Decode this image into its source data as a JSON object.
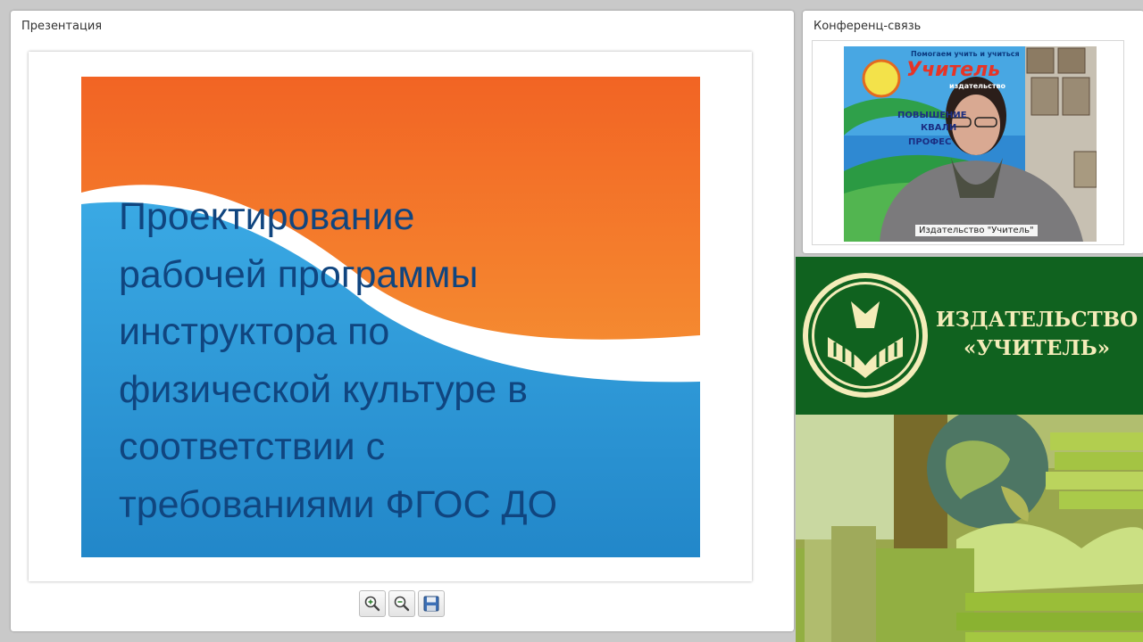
{
  "presentation": {
    "title": "Презентация",
    "slide": {
      "title": "Проектирование\nрабочей программы\nинструктора по\nфизической культуре в\nсоответствии с\nтребованиями ФГОС ДО"
    },
    "toolbar": {
      "zoom_in_icon": "zoom-in-icon",
      "zoom_out_icon": "zoom-out-icon",
      "save_icon": "save-icon"
    }
  },
  "conference": {
    "title": "Конференц-связь",
    "video": {
      "banner_slogan": "Помогаем учить и учиться",
      "banner_brand": "Учитель",
      "banner_sub": "издательство",
      "banner_line1": "ПОВЫШЕНИЕ",
      "banner_line2": "КВАЛИ",
      "banner_line3": "ПРОФЕС",
      "caption": "Издательство \"Учитель\""
    }
  },
  "publisher": {
    "name": "ИЗДАТЕЛЬСТВО\n«УЧИТЕЛЬ»",
    "colors": {
      "green": "#10621f",
      "cream": "#f4ecb9"
    }
  },
  "colors": {
    "slide_orange": "#f26a24",
    "slide_blue": "#2d9ad8",
    "slide_text": "#10457f"
  }
}
